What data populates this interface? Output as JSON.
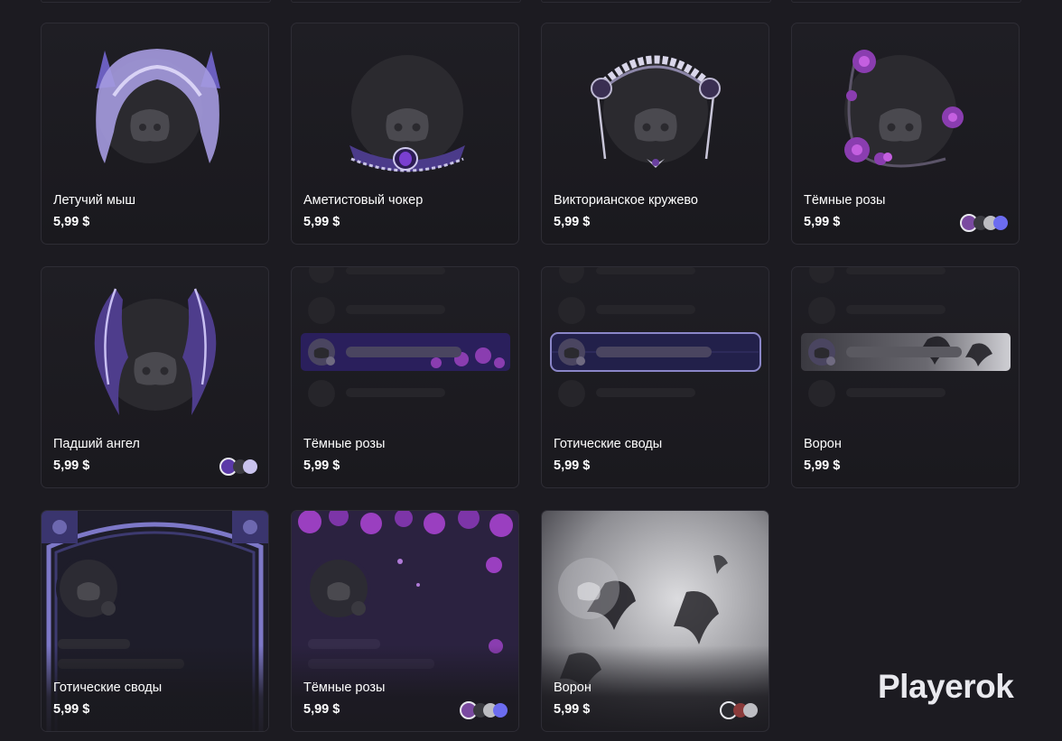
{
  "brand": {
    "watermark": "Playerok"
  },
  "cards": [
    {
      "name": "Летучий мыш",
      "price": "5,99 $",
      "swatches": []
    },
    {
      "name": "Аметистовый чокер",
      "price": "5,99 $",
      "swatches": []
    },
    {
      "name": "Викторианское кружево",
      "price": "5,99 $",
      "swatches": []
    },
    {
      "name": "Тёмные розы",
      "price": "5,99 $",
      "swatches": [
        "#7a4aa0",
        "#3a3a40",
        "#bdbdc2",
        "#6c6cf0"
      ]
    },
    {
      "name": "Падший ангел",
      "price": "5,99 $",
      "swatches": [
        "#5b3aa8",
        "#3a3a40",
        "#c9c3ee"
      ]
    },
    {
      "name": "Тёмные розы",
      "price": "5,99 $",
      "swatches": []
    },
    {
      "name": "Готические своды",
      "price": "5,99 $",
      "swatches": []
    },
    {
      "name": "Ворон",
      "price": "5,99 $",
      "swatches": []
    },
    {
      "name": "Готические своды",
      "price": "5,99 $",
      "swatches": []
    },
    {
      "name": "Тёмные розы",
      "price": "5,99 $",
      "swatches": [
        "#7a4aa0",
        "#3a3a40",
        "#bdbdc2",
        "#6c6cf0"
      ]
    },
    {
      "name": "Ворон",
      "price": "5,99 $",
      "swatches": [
        "#2a2a30",
        "#8a3a3a",
        "#bdbdc2"
      ]
    }
  ]
}
